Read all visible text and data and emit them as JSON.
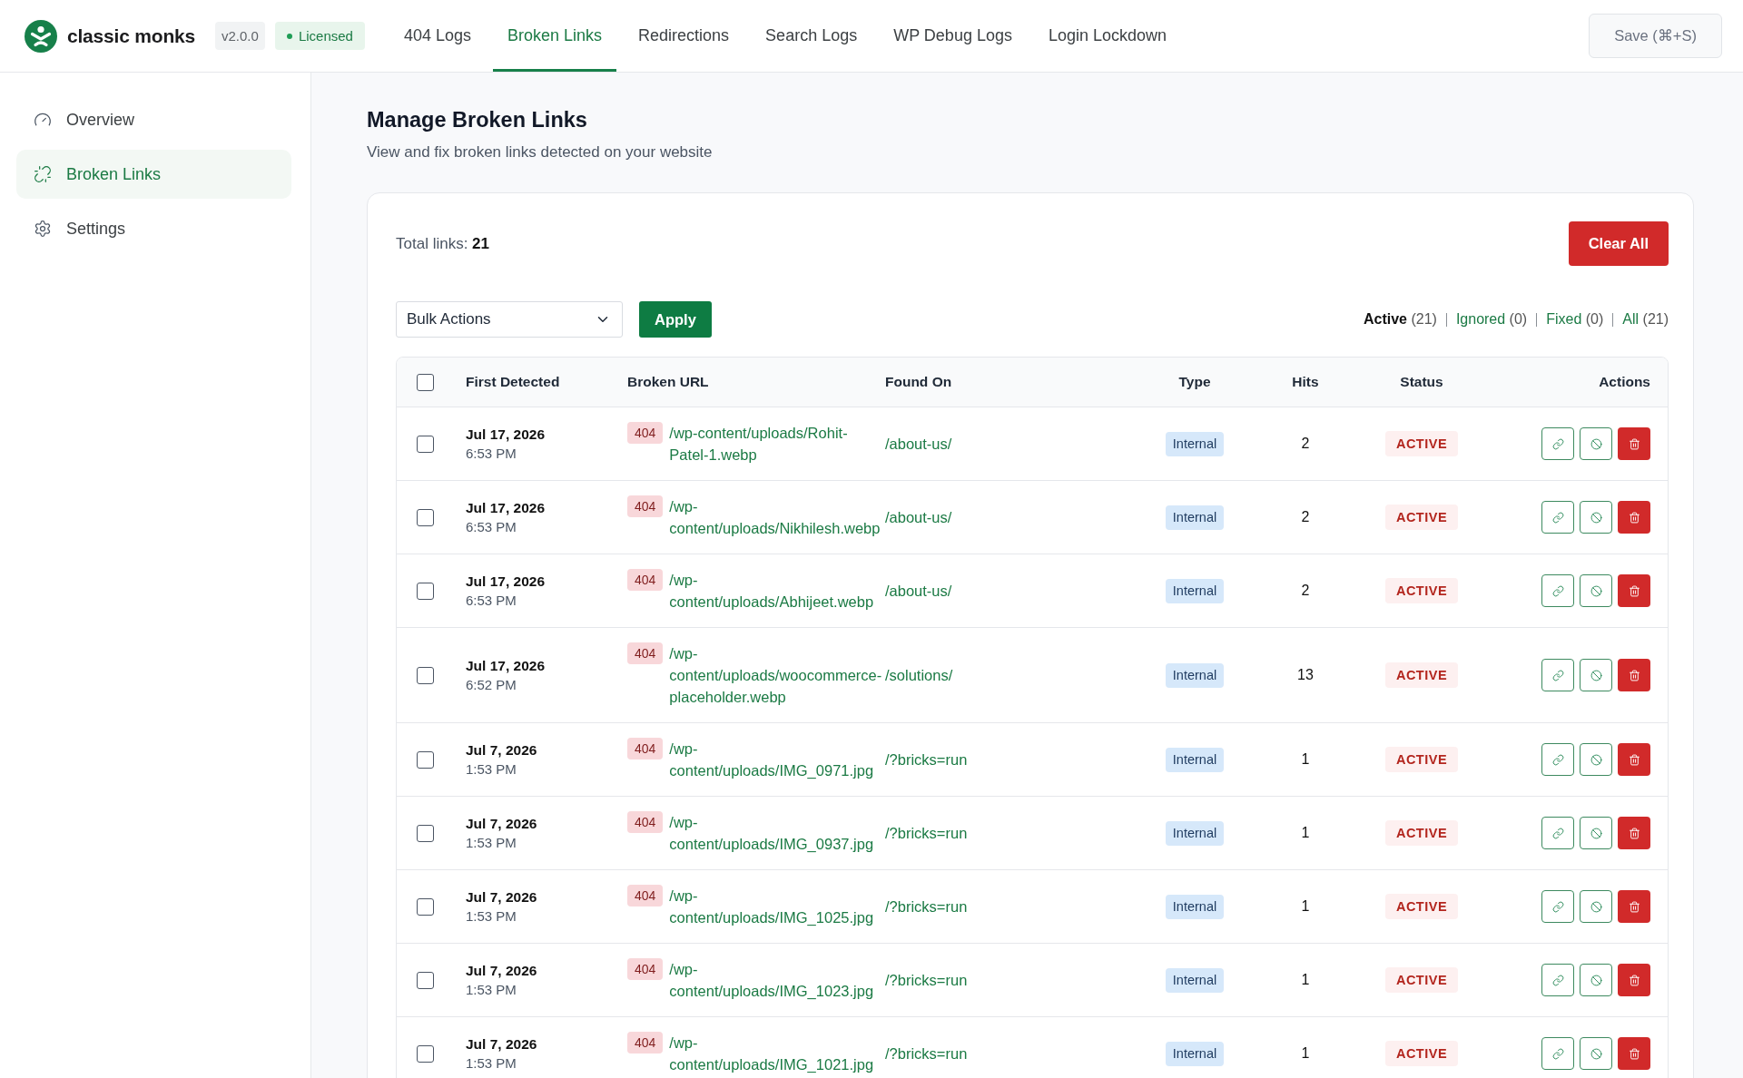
{
  "header": {
    "logo_text": "classic monks",
    "version": "v2.0.0",
    "license_status": "Licensed",
    "nav_tabs": [
      {
        "label": "404 Logs",
        "selected": false
      },
      {
        "label": "Broken Links",
        "selected": true
      },
      {
        "label": "Redirections",
        "selected": false
      },
      {
        "label": "Search Logs",
        "selected": false
      },
      {
        "label": "WP Debug Logs",
        "selected": false
      },
      {
        "label": "Login Lockdown",
        "selected": false
      }
    ],
    "save_button": {
      "label": "Save (⌘+S)",
      "disabled": true
    }
  },
  "sidebar": {
    "items": [
      {
        "label": "Overview",
        "selected": false
      },
      {
        "label": "Broken Links",
        "selected": true
      },
      {
        "label": "Settings",
        "selected": false
      }
    ]
  },
  "page": {
    "title": "Manage Broken Links",
    "subtitle": "View and fix broken links detected on your website"
  },
  "summary": {
    "text": "Total links: **21**"
  },
  "clear_button": "Clear All",
  "bulk_actions": {
    "value": "Bulk Actions",
    "apply_button": "Apply"
  },
  "filters": [
    {
      "label": "Active",
      "count": "(21)",
      "selected": true
    },
    {
      "label": "Ignored",
      "count": "(0)",
      "selected": false
    },
    {
      "label": "Fixed",
      "count": "(0)",
      "selected": false
    },
    {
      "label": "All",
      "count": "(21)",
      "selected": false
    }
  ],
  "table": {
    "header_checkbox": {
      "checked": false
    },
    "columns": [
      "First Detected",
      "Broken URL",
      "Found On",
      "Type",
      "Hits",
      "Status",
      "Actions"
    ],
    "rows": [
      {
        "checked": false,
        "date": "Jul 17, 2026",
        "time": "6:53 PM",
        "code": "404",
        "url": "/wp-content/uploads/Rohit-Patel-1.webp",
        "found_on": "/about-us/",
        "type": "Internal",
        "hits": "2",
        "status": "ACTIVE"
      },
      {
        "checked": false,
        "date": "Jul 17, 2026",
        "time": "6:53 PM",
        "code": "404",
        "url": "/wp-content/uploads/Nikhilesh.webp",
        "found_on": "/about-us/",
        "type": "Internal",
        "hits": "2",
        "status": "ACTIVE"
      },
      {
        "checked": false,
        "date": "Jul 17, 2026",
        "time": "6:53 PM",
        "code": "404",
        "url": "/wp-content/uploads/Abhijeet.webp",
        "found_on": "/about-us/",
        "type": "Internal",
        "hits": "2",
        "status": "ACTIVE"
      },
      {
        "checked": false,
        "date": "Jul 17, 2026",
        "time": "6:52 PM",
        "code": "404",
        "url": "/wp-content/uploads/woocommerce-placeholder.webp",
        "found_on": "/solutions/",
        "type": "Internal",
        "hits": "13",
        "status": "ACTIVE"
      },
      {
        "checked": false,
        "date": "Jul 7, 2026",
        "time": "1:53 PM",
        "code": "404",
        "url": "/wp-content/uploads/IMG_0971.jpg",
        "found_on": "/?bricks=run",
        "type": "Internal",
        "hits": "1",
        "status": "ACTIVE"
      },
      {
        "checked": false,
        "date": "Jul 7, 2026",
        "time": "1:53 PM",
        "code": "404",
        "url": "/wp-content/uploads/IMG_0937.jpg",
        "found_on": "/?bricks=run",
        "type": "Internal",
        "hits": "1",
        "status": "ACTIVE"
      },
      {
        "checked": false,
        "date": "Jul 7, 2026",
        "time": "1:53 PM",
        "code": "404",
        "url": "/wp-content/uploads/IMG_1025.jpg",
        "found_on": "/?bricks=run",
        "type": "Internal",
        "hits": "1",
        "status": "ACTIVE"
      },
      {
        "checked": false,
        "date": "Jul 7, 2026",
        "time": "1:53 PM",
        "code": "404",
        "url": "/wp-content/uploads/IMG_1023.jpg",
        "found_on": "/?bricks=run",
        "type": "Internal",
        "hits": "1",
        "status": "ACTIVE"
      },
      {
        "checked": false,
        "date": "Jul 7, 2026",
        "time": "1:53 PM",
        "code": "404",
        "url": "/wp-content/uploads/IMG_1021.jpg",
        "found_on": "/?bricks=run",
        "type": "Internal",
        "hits": "1",
        "status": "ACTIVE"
      }
    ]
  }
}
